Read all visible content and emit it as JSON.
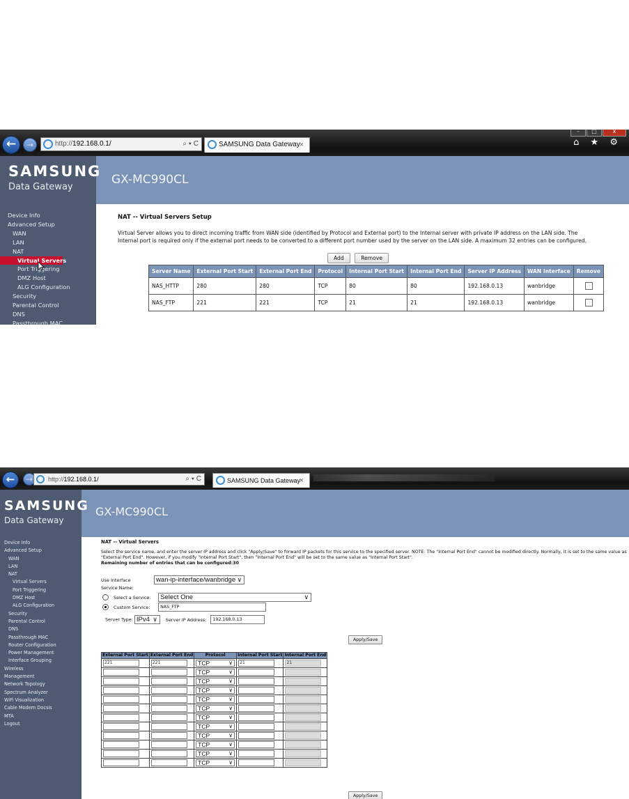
{
  "shot1": {
    "browser": {
      "url_prefix": "http://",
      "url_host": "192.168.0.1/",
      "search_refresh": "⌕ ▾ C",
      "tab_title": "SAMSUNG Data Gateway",
      "tab_close": "×",
      "toolbar_icons": "⌂ ★ ⚙",
      "win_min": "–",
      "win_max": "□",
      "win_close": "x"
    },
    "brand": "SAMSUNG",
    "brand_sub": "Data Gateway",
    "model": "GX-MC990CL",
    "sidebar": [
      "Device Info",
      "Advanced Setup",
      "WAN",
      "LAN",
      "NAT",
      "Virtual Servers",
      "Port Triggering",
      "DMZ Host",
      "ALG Configuration",
      "Security",
      "Parental Control",
      "DNS",
      "Passthrough MAC"
    ],
    "title": "NAT -- Virtual Servers Setup",
    "description": "Virtual Server allows you to direct incoming traffic from WAN side (identified by Protocol and External port) to the Internal server with private IP address on the LAN side. The Internal port is required only if the external port needs to be converted to a different port number used by the server on the LAN side. A maximum 32 entries can be configured.",
    "add_label": "Add",
    "remove_label": "Remove",
    "table": {
      "headers": [
        "Server Name",
        "External Port Start",
        "External Port End",
        "Protocol",
        "Internal Port Start",
        "Internal Port End",
        "Server IP Address",
        "WAN Interface",
        "Remove"
      ],
      "rows": [
        [
          "NAS_HTTP",
          "280",
          "280",
          "TCP",
          "80",
          "80",
          "192.168.0.13",
          "wanbridge"
        ],
        [
          "NAS_FTP",
          "221",
          "221",
          "TCP",
          "21",
          "21",
          "192.168.0.13",
          "wanbridge"
        ]
      ]
    }
  },
  "shot2": {
    "browser": {
      "url_prefix": "http://",
      "url_host": "192.168.0.1/",
      "search_refresh": "⌕ ▾ C",
      "tab_title": "SAMSUNG Data Gateway",
      "tab_close": "×"
    },
    "brand": "SAMSUNG",
    "brand_sub": "Data Gateway",
    "model": "GX-MC990CL",
    "sidebar": [
      "Device Info",
      "Advanced Setup",
      "WAN",
      "LAN",
      "NAT",
      "Virtual Servers",
      "Port Triggering",
      "DMZ Host",
      "ALG Configuration",
      "Security",
      "Parental Control",
      "DNS",
      "Passthrough MAC",
      "Router Configuration",
      "Power Management",
      "Interface Grouping",
      "Wireless",
      "Management",
      "Network Topology",
      "Spectrum Analyzer",
      "WiFi Visualization",
      "Cable Modem Docsis",
      "MTA",
      "Logout"
    ],
    "title": "NAT -- Virtual Servers",
    "description_1": "Select the service name, and enter the server IP address and click \"Apply/Save\" to forward IP packets for this service to the specified server. NOTE: The \"Internal Port End\" cannot be modified directly. Normally, it is set to the same value as \"External Port End\". However, if you modify \"Internal Port Start\", then \"Internal Port End\" will be set to the same value as \"Internal Port Start\".",
    "description_2": "Remaining number of entries that can be configured:30",
    "use_interface_label": "Use Interface",
    "use_interface_value": "wan-ip-interface/wanbridge",
    "service_name_label": "Service Name:",
    "select_service_label": "Select a Service:",
    "select_service_value": "Select One",
    "custom_service_label": "Custom Service:",
    "custom_service_value": "NAS_FTP",
    "server_type_label": "Server Type:",
    "server_type_value": "IPv4",
    "server_ip_label": "Server IP Address:",
    "server_ip_value": "192.168.0.13",
    "apply_label": "Apply/Save",
    "port_headers": [
      "External Port Start",
      "External Port End",
      "Protocol",
      "Internal Port Start",
      "Internal Port End"
    ],
    "port_rows": [
      [
        "221",
        "221",
        "TCP",
        "21",
        "21"
      ],
      [
        "",
        "",
        "TCP",
        "",
        ""
      ],
      [
        "",
        "",
        "TCP",
        "",
        ""
      ],
      [
        "",
        "",
        "TCP",
        "",
        ""
      ],
      [
        "",
        "",
        "TCP",
        "",
        ""
      ],
      [
        "",
        "",
        "TCP",
        "",
        ""
      ],
      [
        "",
        "",
        "TCP",
        "",
        ""
      ],
      [
        "",
        "",
        "TCP",
        "",
        ""
      ],
      [
        "",
        "",
        "TCP",
        "",
        ""
      ],
      [
        "",
        "",
        "TCP",
        "",
        ""
      ],
      [
        "",
        "",
        "TCP",
        "",
        ""
      ],
      [
        "",
        "",
        "TCP",
        "",
        ""
      ]
    ]
  }
}
